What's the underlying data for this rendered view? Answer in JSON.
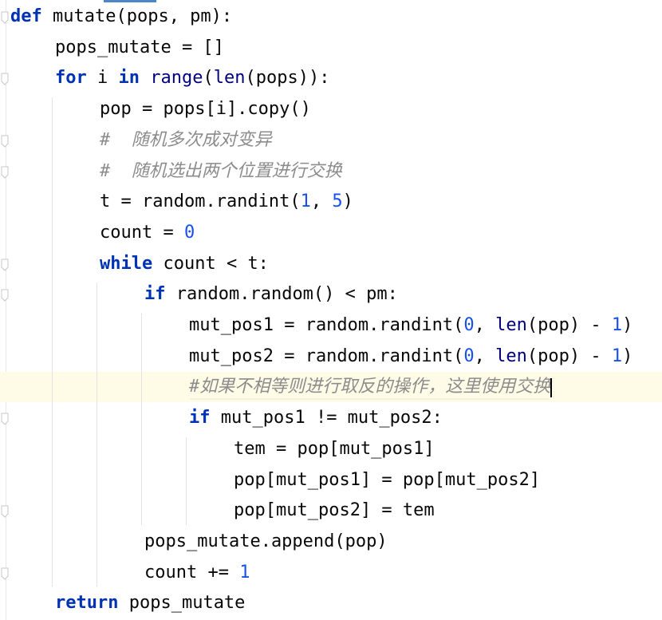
{
  "editor": {
    "lines": [
      {
        "indent": 0,
        "tokens": [
          {
            "t": "def",
            "c": "kw"
          },
          {
            "t": " mutate(pops, pm):",
            "c": "op"
          }
        ]
      },
      {
        "indent": 1,
        "tokens": [
          {
            "t": "pops_mutate = []",
            "c": "op"
          }
        ]
      },
      {
        "indent": 1,
        "tokens": [
          {
            "t": "for",
            "c": "kw"
          },
          {
            "t": " i ",
            "c": "op"
          },
          {
            "t": "in",
            "c": "kw"
          },
          {
            "t": " ",
            "c": "op"
          },
          {
            "t": "range",
            "c": "bi"
          },
          {
            "t": "(",
            "c": "op"
          },
          {
            "t": "len",
            "c": "bi"
          },
          {
            "t": "(pops)):",
            "c": "op"
          }
        ]
      },
      {
        "indent": 2,
        "tokens": [
          {
            "t": "pop = pops[i].copy()",
            "c": "op"
          }
        ]
      },
      {
        "indent": 2,
        "tokens": [
          {
            "t": "#  随机多次成对变异",
            "c": "cm"
          }
        ]
      },
      {
        "indent": 2,
        "tokens": [
          {
            "t": "#  随机选出两个位置进行交换",
            "c": "cm"
          }
        ]
      },
      {
        "indent": 2,
        "tokens": [
          {
            "t": "t = random.randint(",
            "c": "op"
          },
          {
            "t": "1",
            "c": "num"
          },
          {
            "t": ", ",
            "c": "op"
          },
          {
            "t": "5",
            "c": "num"
          },
          {
            "t": ")",
            "c": "op"
          }
        ]
      },
      {
        "indent": 2,
        "tokens": [
          {
            "t": "count = ",
            "c": "op"
          },
          {
            "t": "0",
            "c": "num"
          }
        ]
      },
      {
        "indent": 2,
        "tokens": [
          {
            "t": "while",
            "c": "kw"
          },
          {
            "t": " count < t:",
            "c": "op"
          }
        ]
      },
      {
        "indent": 3,
        "tokens": [
          {
            "t": "if",
            "c": "kw"
          },
          {
            "t": " random.random() < pm:",
            "c": "op"
          }
        ]
      },
      {
        "indent": 4,
        "tokens": [
          {
            "t": "mut_pos1 = random.randint(",
            "c": "op"
          },
          {
            "t": "0",
            "c": "num"
          },
          {
            "t": ", ",
            "c": "op"
          },
          {
            "t": "len",
            "c": "bi"
          },
          {
            "t": "(pop) - ",
            "c": "op"
          },
          {
            "t": "1",
            "c": "num"
          },
          {
            "t": ")",
            "c": "op"
          }
        ]
      },
      {
        "indent": 4,
        "tokens": [
          {
            "t": "mut_pos2 = random.randint(",
            "c": "op"
          },
          {
            "t": "0",
            "c": "num"
          },
          {
            "t": ", ",
            "c": "op"
          },
          {
            "t": "len",
            "c": "bi"
          },
          {
            "t": "(pop) - ",
            "c": "op"
          },
          {
            "t": "1",
            "c": "num"
          },
          {
            "t": ")",
            "c": "op"
          }
        ]
      },
      {
        "indent": 4,
        "tokens": [
          {
            "t": "#如果不相等则进行取反的操作，这里使用交换",
            "c": "cm"
          }
        ]
      },
      {
        "indent": 4,
        "tokens": [
          {
            "t": "if",
            "c": "kw"
          },
          {
            "t": " mut_pos1 != mut_pos2:",
            "c": "op"
          }
        ]
      },
      {
        "indent": 5,
        "tokens": [
          {
            "t": "tem = pop[mut_pos1]",
            "c": "op"
          }
        ]
      },
      {
        "indent": 5,
        "tokens": [
          {
            "t": "pop[mut_pos1] = pop[mut_pos2]",
            "c": "op"
          }
        ]
      },
      {
        "indent": 5,
        "tokens": [
          {
            "t": "pop[mut_pos2] = tem",
            "c": "op"
          }
        ]
      },
      {
        "indent": 3,
        "tokens": [
          {
            "t": "pops_mutate.append(pop)",
            "c": "op"
          }
        ]
      },
      {
        "indent": 3,
        "tokens": [
          {
            "t": "count += ",
            "c": "op"
          },
          {
            "t": "1",
            "c": "num"
          }
        ]
      },
      {
        "indent": 1,
        "tokens": [
          {
            "t": "return",
            "c": "kw"
          },
          {
            "t": " pops_mutate",
            "c": "op"
          }
        ]
      }
    ],
    "current_line_index": 12,
    "fold_markers": [
      0,
      2,
      4,
      5,
      8,
      9,
      13,
      16,
      18
    ]
  },
  "colors": {
    "keyword": "#0033b3",
    "builtin": "#000080",
    "number": "#1750eb",
    "comment": "#8c8c8c",
    "text": "#080808",
    "current_line_bg": "#fefbe7"
  },
  "icons": {
    "fold_marker": "fold-marker-icon",
    "caret": "text-caret"
  }
}
